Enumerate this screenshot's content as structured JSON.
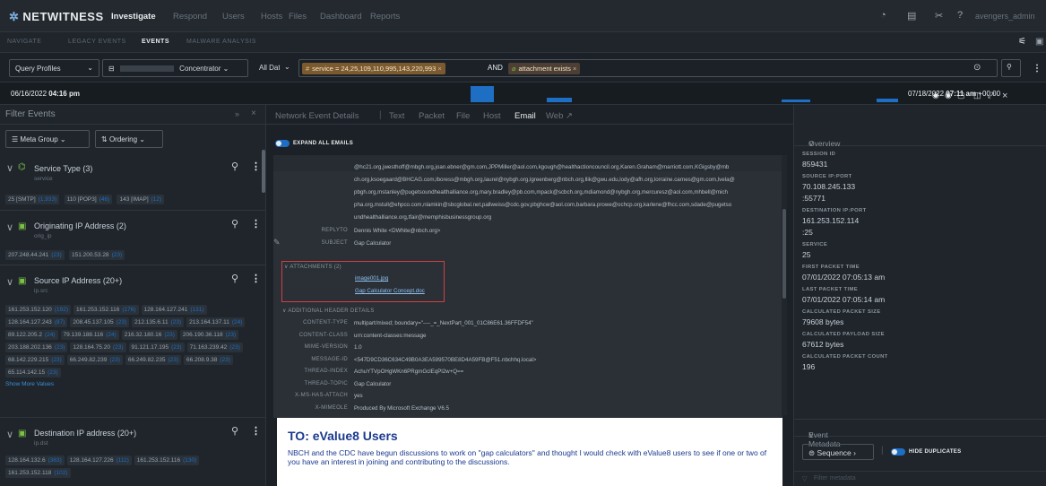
{
  "nav": {
    "logo": "NETWITNESS",
    "items": [
      "Investigate",
      "Respond",
      "Users",
      "Hosts",
      "Files",
      "Dashboard",
      "Reports"
    ],
    "user": "avengers_admin"
  },
  "subnav": [
    "NAVIGATE",
    "LEGACY EVENTS",
    "EVENTS",
    "MALWARE ANALYSIS"
  ],
  "query": {
    "profiles_label": "Query Profiles",
    "concentrator_label": "Concentrator",
    "range_label": "All Data",
    "pill1": "service = 24,25,109,110,995,143,220,993",
    "and_label": "AND",
    "pill2": "attachment exists"
  },
  "timeline": {
    "start_date": "06/16/2022",
    "start_time": "04:16 pm",
    "end_date": "07/18/2022",
    "end_time": "07:11 am",
    "end_tz": "+00:00"
  },
  "filter": {
    "title": "Filter Events",
    "meta_group": "Meta Group",
    "ordering": "Ordering",
    "keys": [
      {
        "title": "Service Type (3)",
        "sub": "service",
        "values": [
          {
            "v": "25 [SMTP]",
            "c": "(1,933)"
          },
          {
            "v": "110 [POP3]",
            "c": "(46)"
          },
          {
            "v": "143 [IMAP]",
            "c": "(12)"
          }
        ]
      },
      {
        "title": "Originating IP Address (2)",
        "sub": "orig_ip",
        "values": [
          {
            "v": "207.248.44.241",
            "c": "(23)"
          },
          {
            "v": "151.200.53.28",
            "c": "(23)"
          }
        ]
      },
      {
        "title": "Source IP Address (20+)",
        "sub": "ip.src",
        "values": [
          {
            "v": "161.253.152.120",
            "c": "(192)"
          },
          {
            "v": "161.253.152.116",
            "c": "(176)"
          },
          {
            "v": "128.164.127.241",
            "c": "(131)"
          },
          {
            "v": "128.164.127.243",
            "c": "(87)"
          },
          {
            "v": "208.45.137.105",
            "c": "(23)"
          },
          {
            "v": "212.135.6.11",
            "c": "(23)"
          },
          {
            "v": "213.164.137.11",
            "c": "(24)"
          },
          {
            "v": "89.122.205.2",
            "c": "(24)"
          },
          {
            "v": "79.139.188.116",
            "c": "(24)"
          },
          {
            "v": "216.32.180.16",
            "c": "(23)"
          },
          {
            "v": "206.190.36.118",
            "c": "(23)"
          },
          {
            "v": "203.188.202.136",
            "c": "(23)"
          },
          {
            "v": "128.164.75.20",
            "c": "(23)"
          },
          {
            "v": "91.121.17.195",
            "c": "(23)"
          },
          {
            "v": "71.163.239.42",
            "c": "(23)"
          },
          {
            "v": "68.142.229.215",
            "c": "(23)"
          },
          {
            "v": "66.249.82.239",
            "c": "(23)"
          },
          {
            "v": "66.249.82.235",
            "c": "(23)"
          },
          {
            "v": "66.208.9.38",
            "c": "(23)"
          },
          {
            "v": "65.114.142.15",
            "c": "(23)"
          }
        ],
        "more": "Show More Values"
      },
      {
        "title": "Destination IP address (20+)",
        "sub": "ip.dst",
        "values": [
          {
            "v": "128.164.132.6",
            "c": "(383)"
          },
          {
            "v": "128.164.127.226",
            "c": "(111)"
          },
          {
            "v": "161.253.152.116",
            "c": "(130)"
          },
          {
            "v": "161.253.152.118",
            "c": "(102)"
          }
        ]
      }
    ]
  },
  "center": {
    "tabs": [
      "Network Event Details",
      "Text",
      "Packet",
      "File",
      "Host",
      "Email",
      "Web"
    ],
    "expand_label": "EXPAND ALL EMAILS",
    "to_lines": [
      "@hc21.org,jwesthoff@mbgh.org,joan.ebner@gm.com,JPPMiller@aol.com,kgough@healthactioncouncil.org,Karen.Graham@marriott.com,KGigsby@mb",
      "ch.org,ksoegaard@BHCAG.com,lboress@mbgh.org,laurel@nybgh.org,lgreenberg@nbch.org,llik@gwu.edu,lody@afh.org,lorraine.carnes@gm.com,lvela@",
      "pbgh.org,mstanley@pugetsoundhealthalliance.org,mary.bradley@pb.com,mpack@scbch.org,mdiamond@nybgh.org,mercuresz@aol.com,mhbell@mich",
      "pha.org,mstull@ehpco.com,nlamkin@sbcglobal.net,pallweiss@cdc.gov,pbghcw@aol.com,barbara.prowe@ochcp.org,karlene@fhcc.com,sdade@pugetso",
      "undhealthalliance.org,tfair@memphisbusinessgroup.org"
    ],
    "replyto_label": "REPLYTO",
    "replyto": "Dennis White <DWhite@nbch.org>",
    "subject_label": "SUBJECT",
    "subject": "Gap Calculator",
    "attachments_label": "ATTACHMENTS (2)",
    "attachments": [
      "image001.jpg",
      "Gap Calculator Concept.doc"
    ],
    "additional_label": "ADDITIONAL HEADER DETAILS",
    "headers": [
      {
        "k": "CONTENT-TYPE",
        "v": "multipart/mixed; boundary=\"----_=_NextPart_001_01C86E61.36FFDF54\""
      },
      {
        "k": "CONTENT-CLASS",
        "v": "urn:content-classes:message"
      },
      {
        "k": "MIME-VERSION",
        "v": "1.0"
      },
      {
        "k": "MESSAGE-ID",
        "v": "<547D9CD36C634C49B0A3EA599570BE8D4A59FB@F51.nbchhq.local>"
      },
      {
        "k": "THREAD-INDEX",
        "v": "AchuYTVpOHgWKn6PRgmGclEqPl2w+Q=="
      },
      {
        "k": "THREAD-TOPIC",
        "v": "Gap Calculator"
      },
      {
        "k": "X-MS-HAS-ATTACH",
        "v": "yes"
      },
      {
        "k": "X-MIMEOLE",
        "v": "Produced By Microsoft Exchange V6.5"
      }
    ],
    "body_title": "TO: eValue8 Users",
    "body_text": "NBCH and the CDC have begun discussions to work on \"gap calculators\" and thought I would check with eValue8 users to see if one or two of you have an interest in joining and contributing to the discussions."
  },
  "right": {
    "overview": "Overview",
    "fields": [
      {
        "k": "SESSION ID",
        "v": [
          "859431"
        ]
      },
      {
        "k": "SOURCE IP:PORT",
        "v": [
          "70.108.245.133",
          ":55771"
        ]
      },
      {
        "k": "DESTINATION IP:PORT",
        "v": [
          "161.253.152.114",
          ":25"
        ]
      },
      {
        "k": "SERVICE",
        "v": [
          "25"
        ]
      },
      {
        "k": "FIRST PACKET TIME",
        "v": [
          "07/01/2022 07:05:13 am"
        ]
      },
      {
        "k": "LAST PACKET TIME",
        "v": [
          "07/01/2022 07:05:14 am"
        ]
      },
      {
        "k": "CALCULATED PACKET SIZE",
        "v": [
          "79608 bytes"
        ]
      },
      {
        "k": "CALCULATED PAYLOAD SIZE",
        "v": [
          "67612 bytes"
        ]
      },
      {
        "k": "CALCULATED PACKET COUNT",
        "v": [
          "196"
        ]
      }
    ],
    "event_metadata": "Event Metadata",
    "sequence_label": "Sequence",
    "hide_duplicates": "HIDE DUPLICATES",
    "filter_placeholder": "Filter metadata"
  },
  "colors": {
    "accent": "#1e6fc4",
    "pill": "#7a5a2e",
    "highlight_box": "#d04040",
    "email_body_text": "#1a3a8f"
  }
}
